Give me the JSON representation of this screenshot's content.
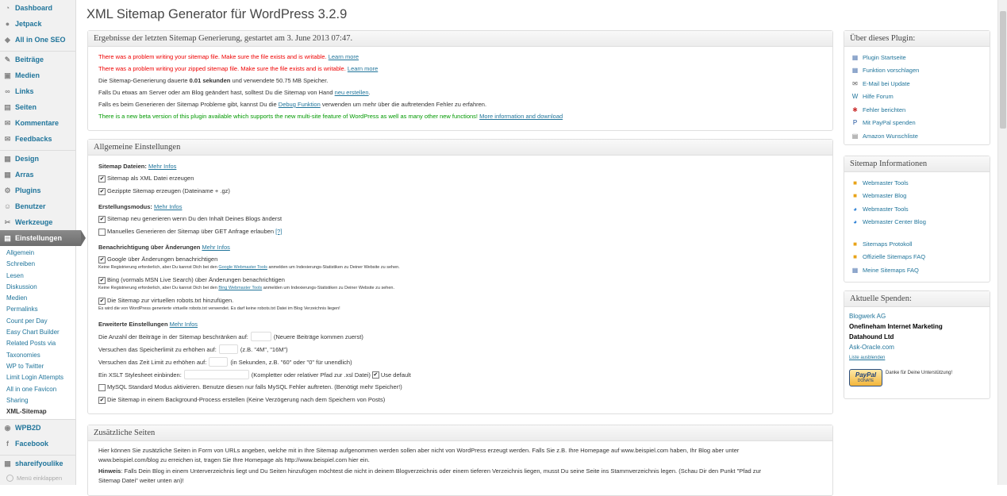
{
  "sidebar": {
    "top": [
      {
        "label": "Dashboard",
        "icon": "dashboard-icon",
        "glyph": "◔"
      },
      {
        "label": "Jetpack",
        "icon": "jetpack-icon",
        "glyph": "●"
      },
      {
        "label": "All in One SEO",
        "icon": "shield-icon",
        "glyph": "◆"
      }
    ],
    "content": [
      {
        "label": "Beiträge",
        "icon": "pin-icon",
        "glyph": "✎"
      },
      {
        "label": "Medien",
        "icon": "media-icon",
        "glyph": "▣"
      },
      {
        "label": "Links",
        "icon": "link-icon",
        "glyph": "∞"
      },
      {
        "label": "Seiten",
        "icon": "page-icon",
        "glyph": "▤"
      },
      {
        "label": "Kommentare",
        "icon": "comment-icon",
        "glyph": "✉"
      },
      {
        "label": "Feedbacks",
        "icon": "feedback-icon",
        "glyph": "✉"
      }
    ],
    "admin": [
      {
        "label": "Design",
        "icon": "design-icon",
        "glyph": "▦"
      },
      {
        "label": "Arras",
        "icon": "theme-icon",
        "glyph": "▦"
      },
      {
        "label": "Plugins",
        "icon": "plugin-icon",
        "glyph": "⚙"
      },
      {
        "label": "Benutzer",
        "icon": "user-icon",
        "glyph": "☺"
      },
      {
        "label": "Werkzeuge",
        "icon": "tools-icon",
        "glyph": "✂"
      }
    ],
    "current": {
      "label": "Einstellungen",
      "icon": "settings-icon",
      "glyph": "▤"
    },
    "submenu": [
      "Allgemein",
      "Schreiben",
      "Lesen",
      "Diskussion",
      "Medien",
      "Permalinks",
      "Count per Day",
      "Easy Chart Builder",
      "Related Posts via",
      "Taxonomies",
      "WP to Twitter",
      "Limit Login Attempts",
      "All in one Favicon",
      "Sharing",
      "XML-Sitemap"
    ],
    "bottom": [
      {
        "label": "WPB2D",
        "icon": "wpb2d-icon",
        "glyph": "◉"
      },
      {
        "label": "Facebook",
        "icon": "facebook-icon",
        "glyph": "f"
      }
    ],
    "extra": {
      "label": "shareifyoulike",
      "icon": "share-icon",
      "glyph": "▩"
    },
    "collapse": "Menü einklappen"
  },
  "page": {
    "title": "XML Sitemap Generator für WordPress 3.2.9"
  },
  "results": {
    "title": "Ergebnisse der letzten Sitemap Generierung, gestartet am 3. June 2013 07:47.",
    "err1": "There was a problem writing your sitemap file. Make sure the file exists and is writable.",
    "err2": "There was a problem writing your zipped sitemap file. Make sure the file exists and is writable.",
    "learn": "Learn more",
    "dur_pre": "Die Sitemap-Generierung dauerte",
    "dur_val": "0.01 sekunden",
    "dur_post": "und verwendete 50.75 MB Speicher.",
    "changed_pre": "Falls Du etwas am Server oder am Blog geändert hast, solltest Du die Sitemap von Hand",
    "changed_link": "neu erstellen",
    "changed_post": ".",
    "debug_pre": "Falls es beim Generieren der Sitemap Probleme gibt, kannst Du die",
    "debug_link": "Debug Funktion",
    "debug_post": "verwenden um mehr über die auftretenden Fehler zu erfahren.",
    "beta": "There is a new beta version of this plugin available which supports the new multi-site feature of WordPress as well as many other new functions!",
    "beta_link": "More information and download"
  },
  "general": {
    "title": "Allgemeine Einstellungen",
    "more": "Mehr Infos",
    "files_label": "Sitemap Dateien:",
    "cb_xml": "Sitemap als XML Datei erzeugen",
    "cb_gz": "Gezippte Sitemap erzeugen (Dateiname + .gz)",
    "mode_label": "Erstellungsmodus:",
    "cb_rebuild": "Sitemap neu generieren wenn Du den Inhalt Deines Blogs änderst",
    "cb_get": "Manuelles Generieren der Sitemap über GET Anfrage erlauben",
    "q": "[?]",
    "notify_label": "Benachrichtigung über Änderungen",
    "cb_google": "Google über Änderungen benachrichtigen",
    "note_google_pre": "Keine Registrierung erforderlich, aber Du kannst Dich bei den",
    "note_google_link": "Google Webmaster Tools",
    "note_post": "anmelden um Indexierungs-Statistiken zu Deiner Website zu sehen.",
    "cb_bing": "Bing (vormals MSN Live Search) über Änderungen benachrichtigen",
    "note_bing_link": "Bing Webmaster Tools",
    "cb_robots": "Die Sitemap zur virtuellen robots.txt hinzufügen.",
    "note_robots": "Es wird die von WordPress generierte virtuelle robots.txt verwendet. Es darf keine robots.txt Datei im Blog Verzeichnis liegen!",
    "adv_label": "Erweiterte Einstellungen",
    "limit_pre": "Die Anzahl der Beiträge in der Sitemap beschränken auf:",
    "limit_post": "(Neuere Beiträge kommen zuerst)",
    "mem_pre": "Versuchen das Speicherlimit zu erhöhen auf:",
    "mem_post": "(z.B. \"4M\", \"16M\")",
    "time_pre": "Versuchen das Zeit Limit zu erhöhen auf:",
    "time_post": "(in Sekunden, z.B. \"60\" oder \"0\" für unendlich)",
    "xslt_pre": "Ein XSLT Stylesheet einbinden:",
    "xslt_post": "(Kompletter oder relativer Pfad zur .xsl Datei)",
    "use_default": "Use default",
    "cb_mysql": "MySQL Standard Modus aktivieren. Benutze diesen nur falls MySQL Fehler auftreten. (Benötigt mehr Speicher!)",
    "cb_bg": "Die Sitemap in einem Background-Process erstellen (Keine Verzögerung nach dem Speichern von Posts)"
  },
  "extra": {
    "title": "Zusätzliche Seiten",
    "p1a": "Hier können Sie zusätzliche Seiten in Form von URLs angeben, welche mit in Ihre Sitemap aufgenommen werden sollen aber nicht von WordPress erzeugt werden. Falls Sie z.B. Ihre Homepage auf www.beispiel.com haben, Ihr Blog aber unter",
    "p1b": "www.beispiel.com/blog zu erreichen ist, tragen Sie Ihre Homepage als http://www.beispiel.com hier ein.",
    "hint_label": "Hinweis",
    "p2a": ": Falls Dein Blog in einem Unterverzeichnis liegt und Du Seiten hinzufügen möchtest die nicht in deinem Blogverzeichnis oder einem tieferen Verzeichnis liegen, musst Du seine Seite ins Stammverzeichnis legen. (Schau Dir den Punkt \"Pfad zur",
    "p2b": "Sitemap Datei\" weiter unten an)!"
  },
  "about": {
    "title": "Über dieses Plugin:",
    "links": [
      {
        "label": "Plugin Startseite",
        "icon": "plugin-home-icon",
        "glyph": "▦",
        "color": "#5b7fb5"
      },
      {
        "label": "Funktion vorschlagen",
        "icon": "suggest-icon",
        "glyph": "▦",
        "color": "#5b7fb5"
      },
      {
        "label": "E-Mail bei Update",
        "icon": "email-icon",
        "glyph": "✉",
        "color": "#555555"
      },
      {
        "label": "Hilfe Forum",
        "icon": "wordpress-icon",
        "glyph": "W",
        "color": "#21759b"
      },
      {
        "label": "Fehler berichten",
        "icon": "bug-icon",
        "glyph": "✱",
        "color": "#cc3333"
      },
      {
        "label": "Mit PayPal spenden",
        "icon": "paypal-icon",
        "glyph": "P",
        "color": "#1a4f9c"
      },
      {
        "label": "Amazon Wunschliste",
        "icon": "amazon-icon",
        "glyph": "▤",
        "color": "#777777"
      }
    ]
  },
  "sitemapinfo": {
    "title": "Sitemap Informationen",
    "links": [
      {
        "label": "Webmaster Tools",
        "icon": "google-icon",
        "glyph": "■",
        "color": "#e8a317"
      },
      {
        "label": "Webmaster Blog",
        "icon": "google-icon",
        "glyph": "■",
        "color": "#e8a317"
      },
      {
        "label": "Webmaster Tools",
        "icon": "bing-icon",
        "glyph": "◕",
        "color": "#2a7fd4"
      },
      {
        "label": "Webmaster Center Blog",
        "icon": "bing-icon",
        "glyph": "◕",
        "color": "#2a7fd4"
      }
    ],
    "links2": [
      {
        "label": "Sitemaps Protokoll",
        "icon": "google-icon",
        "glyph": "■",
        "color": "#e8a317"
      },
      {
        "label": "Offizielle Sitemaps FAQ",
        "icon": "google-icon",
        "glyph": "■",
        "color": "#e8a317"
      },
      {
        "label": "Meine Sitemaps FAQ",
        "icon": "page-icon",
        "glyph": "▦",
        "color": "#5b7fb5"
      }
    ]
  },
  "donations": {
    "title": "Aktuelle Spenden:",
    "d1": "Blogwerk AG",
    "d2": "Onefineham Internet Marketing",
    "d3": "Datahound Ltd",
    "d4": "Ask-Oracle.com",
    "hide": "Liste ausblenden",
    "paypal_top": "PayPal",
    "paypal_bottom": "DONATE",
    "thanks": "Danke für Deine Unterstützung!"
  }
}
